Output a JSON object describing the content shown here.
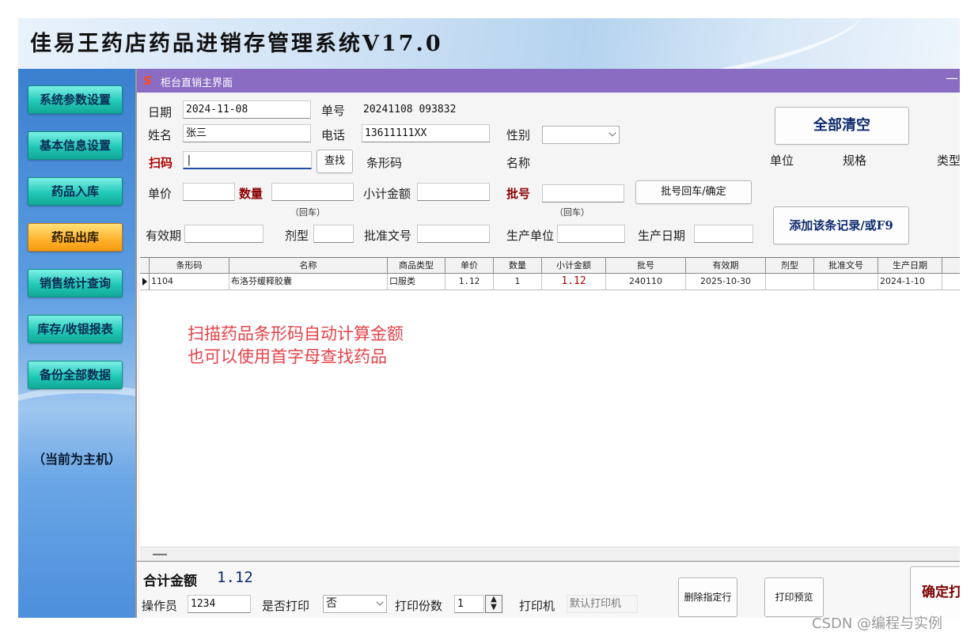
{
  "app": {
    "title": "佳易王药店药品进销存管理系统V17.0"
  },
  "sidebar": {
    "items": [
      {
        "label": "系统参数设置"
      },
      {
        "label": "基本信息设置"
      },
      {
        "label": "药品入库"
      },
      {
        "label": "药品出库"
      },
      {
        "label": "销售统计查询"
      },
      {
        "label": "库存/收银报表"
      },
      {
        "label": "备份全部数据"
      }
    ],
    "host_status": "（当前为主机）"
  },
  "window": {
    "title": "柜台直销主界面",
    "minimize": "—"
  },
  "form": {
    "date_label": "日期",
    "date_value": "2024-11-08",
    "order_label": "单号",
    "order_value": "20241108 093832",
    "name_label": "姓名",
    "name_value": "张三",
    "phone_label": "电话",
    "phone_value": "13611111XX",
    "gender_label": "性别",
    "gender_value": "",
    "scan_label": "扫码",
    "scan_value": "|",
    "find_button": "查找",
    "barcode_label": "条形码",
    "item_name_label": "名称",
    "unit_label": "单位",
    "spec_label": "规格",
    "type_label": "类型",
    "price_label": "单价",
    "price_value": "",
    "qty_label": "数量",
    "qty_value": "",
    "qty_hint": "（回车）",
    "subtotal_label": "小计金额",
    "subtotal_value": "",
    "batch_label": "批号",
    "batch_value": "",
    "batch_hint": "（回车）",
    "batch_button": "批号回车/确定",
    "expiry_label": "有效期",
    "expiry_value": "",
    "form_label": "剂型",
    "form_value": "",
    "approval_label": "批准文号",
    "approval_value": "",
    "maker_label": "生产单位",
    "maker_value": "",
    "mfg_date_label": "生产日期",
    "mfg_date_value": "",
    "clear_all_button": "全部清空",
    "add_record_button": "添加该条记录/或F9"
  },
  "table": {
    "columns": [
      "条形码",
      "名称",
      "商品类型",
      "单价",
      "数量",
      "小计金额",
      "批号",
      "有效期",
      "剂型",
      "批准文号",
      "生产日期"
    ],
    "rows": [
      [
        "1104",
        "布洛芬缓释胶囊",
        "口服类",
        "1.12",
        "1",
        "1.12",
        "240110",
        "2025-10-30",
        "",
        "",
        "2024-1-10"
      ]
    ]
  },
  "annotation": {
    "line1": "扫描药品条形码自动计算金额",
    "line2": "也可以使用首字母查找药品"
  },
  "footer": {
    "total_label": "合计金额",
    "total_value": "1.12",
    "operator_label": "操作员",
    "operator_value": "1234",
    "print_label": "是否打印",
    "print_value": "否",
    "copies_label": "打印份数",
    "copies_value": "1",
    "printer_label": "打印机",
    "printer_value": "默认打印机",
    "delete_button": "删除指定行",
    "preview_button": "打印预览",
    "confirm_button": "确定打"
  },
  "watermark": "CSDN @编程与实例",
  "colors": {
    "titlebar": "#8a6cc2",
    "sidebar_button": "#22c9b8",
    "active_button": "#ffb12b",
    "annotation": "#e3434a"
  }
}
